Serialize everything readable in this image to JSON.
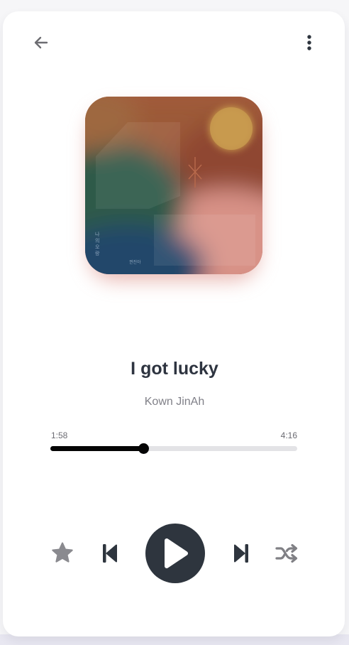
{
  "header": {
    "back_icon": "arrow-left-icon",
    "more_icon": "more-vertical-icon"
  },
  "album": {
    "art_text_vertical": "나의 오랑",
    "art_text_small": "권진아"
  },
  "track": {
    "title": "I got lucky",
    "artist": "Kown JinAh"
  },
  "progress": {
    "current_time": "1:58",
    "total_time": "4:16",
    "fraction": 0.377
  },
  "controls": {
    "favorite_icon": "star-icon",
    "previous_icon": "skip-previous-icon",
    "play_icon": "play-icon",
    "next_icon": "skip-next-icon",
    "shuffle_icon": "shuffle-icon"
  },
  "colors": {
    "accent_dark": "#2e353e",
    "progress_fill": "#050505",
    "progress_track": "#e3e3e6",
    "icon_gray": "#8a8a8f"
  }
}
